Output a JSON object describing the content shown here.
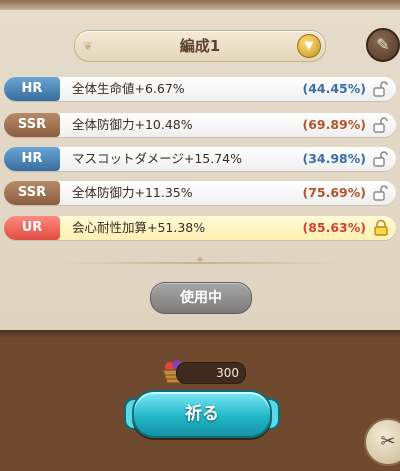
{
  "selector": {
    "label": "編成1",
    "deco_glyph": "❦"
  },
  "colors": {
    "hr": "#3a6ea8",
    "ssr": "#b5542a",
    "ur": "#d04333",
    "pray_button": "#22b8c9"
  },
  "rows": [
    {
      "rarity": "HR",
      "effect": "全体生命値+6.67%",
      "pct": "(44.45%)",
      "locked": false
    },
    {
      "rarity": "SSR",
      "effect": "全体防御力+10.48%",
      "pct": "(69.89%)",
      "locked": false
    },
    {
      "rarity": "HR",
      "effect": "マスコットダメージ+15.74%",
      "pct": "(34.98%)",
      "locked": false
    },
    {
      "rarity": "SSR",
      "effect": "全体防御力+11.35%",
      "pct": "(75.69%)",
      "locked": false
    },
    {
      "rarity": "UR",
      "effect": "会心耐性加算+51.38%",
      "pct": "(85.63%)",
      "locked": true
    }
  ],
  "in_use_label": "使用中",
  "cost": {
    "value": "300",
    "icon": "fruit-basket-icon"
  },
  "pray_label": "祈る",
  "icons": {
    "edit": "quill-icon",
    "dropdown": "chevron-down-icon",
    "lock": "padlock-icon",
    "corner": "swords-icon"
  }
}
